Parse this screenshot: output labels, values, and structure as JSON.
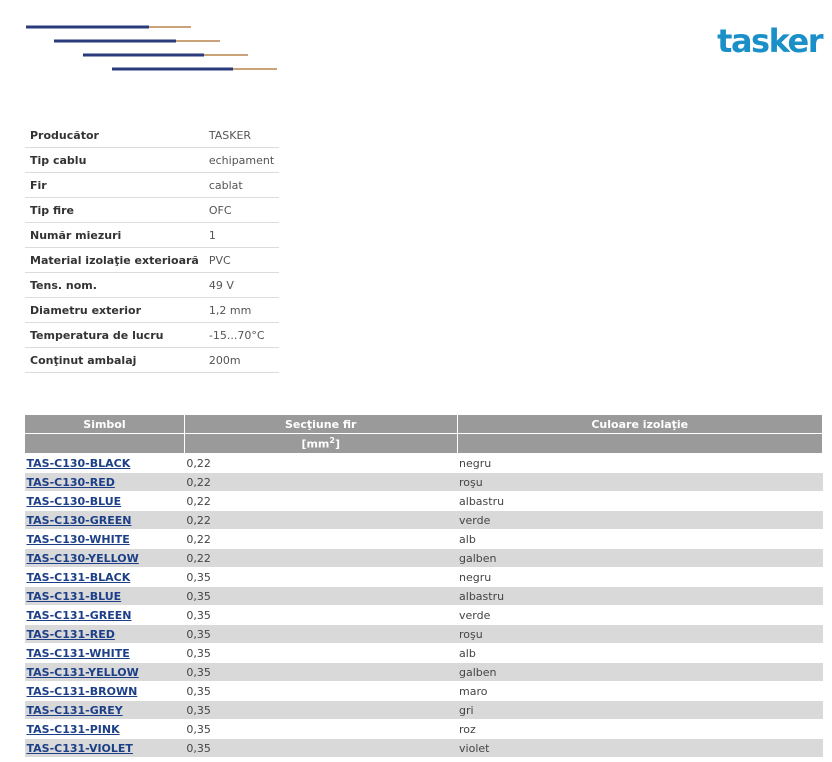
{
  "brand": {
    "logo_text": "tasker",
    "color": "#1a8fc8"
  },
  "specs": [
    {
      "label": "Producător",
      "value": "TASKER"
    },
    {
      "label": "Tip cablu",
      "value": "echipament"
    },
    {
      "label": "Fir",
      "value": "cablat"
    },
    {
      "label": "Tip fire",
      "value": "OFC"
    },
    {
      "label": "Număr miezuri",
      "value": "1"
    },
    {
      "label": "Material izolaţie exterioară",
      "value": "PVC"
    },
    {
      "label": "Tens. nom.",
      "value": "49 V"
    },
    {
      "label": "Diametru exterior",
      "value": "1,2 mm"
    },
    {
      "label": "Temperatura de lucru",
      "value": "-15...70°C"
    },
    {
      "label": "Conţinut ambalaj",
      "value": "200m"
    }
  ],
  "table": {
    "headers": {
      "symbol": "Simbol",
      "section": "Secţiune fir",
      "section_unit": "[mm",
      "section_unit_exp": "2",
      "section_unit_close": "]",
      "color": "Culoare izolaţie"
    },
    "rows": [
      {
        "symbol": "TAS-C130-BLACK",
        "section": "0,22",
        "color": "negru"
      },
      {
        "symbol": "TAS-C130-RED",
        "section": "0,22",
        "color": "roşu"
      },
      {
        "symbol": "TAS-C130-BLUE",
        "section": "0,22",
        "color": "albastru"
      },
      {
        "symbol": "TAS-C130-GREEN",
        "section": "0,22",
        "color": "verde"
      },
      {
        "symbol": "TAS-C130-WHITE",
        "section": "0,22",
        "color": "alb"
      },
      {
        "symbol": "TAS-C130-YELLOW",
        "section": "0,22",
        "color": "galben"
      },
      {
        "symbol": "TAS-C131-BLACK",
        "section": "0,35",
        "color": "negru"
      },
      {
        "symbol": "TAS-C131-BLUE",
        "section": "0,35",
        "color": "albastru"
      },
      {
        "symbol": "TAS-C131-GREEN",
        "section": "0,35",
        "color": "verde"
      },
      {
        "symbol": "TAS-C131-RED",
        "section": "0,35",
        "color": "roşu"
      },
      {
        "symbol": "TAS-C131-WHITE",
        "section": "0,35",
        "color": "alb"
      },
      {
        "symbol": "TAS-C131-YELLOW",
        "section": "0,35",
        "color": "galben"
      },
      {
        "symbol": "TAS-C131-BROWN",
        "section": "0,35",
        "color": "maro"
      },
      {
        "symbol": "TAS-C131-GREY",
        "section": "0,35",
        "color": "gri"
      },
      {
        "symbol": "TAS-C131-PINK",
        "section": "0,35",
        "color": "roz"
      },
      {
        "symbol": "TAS-C131-VIOLET",
        "section": "0,35",
        "color": "violet"
      }
    ]
  }
}
